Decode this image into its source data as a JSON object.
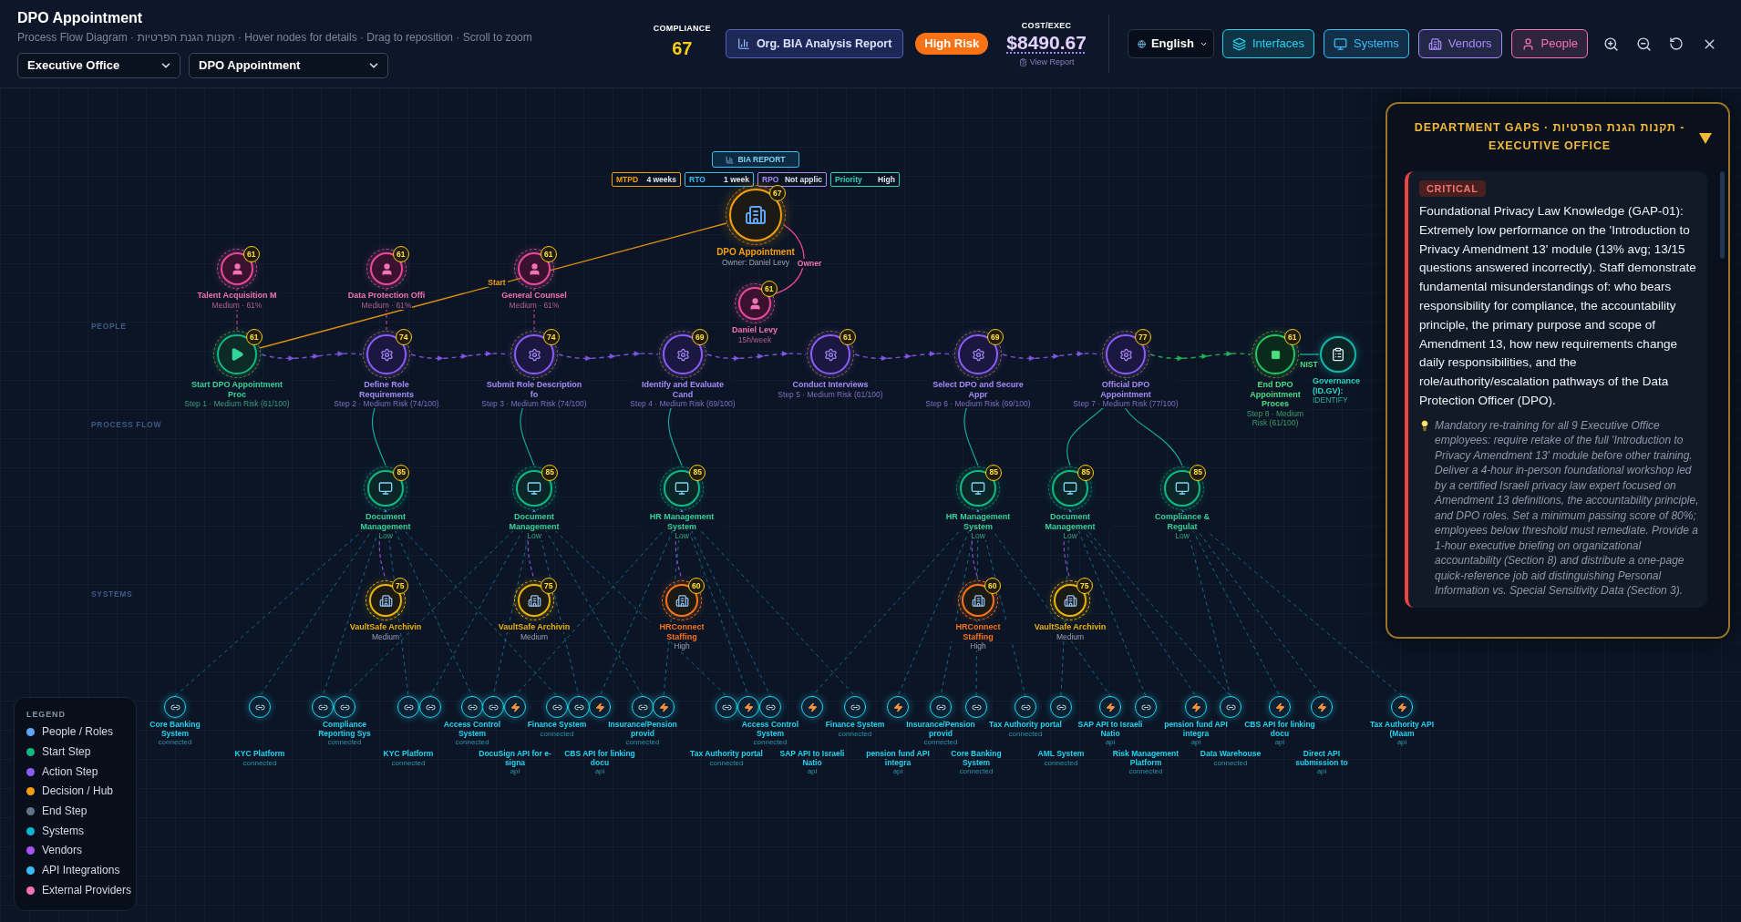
{
  "header": {
    "title": "DPO Appointment",
    "subtitle": "Process Flow Diagram · תקנות הגנת הפרטיות · Hover nodes for details · Drag to reposition · Scroll to zoom",
    "filters": [
      {
        "value": "Executive Office"
      },
      {
        "value": "DPO Appointment"
      }
    ],
    "compliance": {
      "label": "COMPLIANCE",
      "value": "67"
    },
    "report_button": "Org. BIA Analysis Report",
    "risk_badge": "High Risk",
    "cost": {
      "label": "COST/EXEC",
      "value": "$8490.67",
      "link": "View Report"
    },
    "language": "English",
    "layers": [
      {
        "kind": "interfaces",
        "label": "Interfaces",
        "on": true,
        "color": "#22d3ee"
      },
      {
        "kind": "systems",
        "label": "Systems",
        "on": true,
        "color": "#38bdf8"
      },
      {
        "kind": "vendors",
        "label": "Vendors",
        "on": true,
        "color": "#a78bfa"
      },
      {
        "kind": "people",
        "label": "People",
        "on": true,
        "color": "#f472b6"
      }
    ]
  },
  "diagram": {
    "lanes": [
      {
        "label": "PEOPLE"
      },
      {
        "label": "PROCESS FLOW"
      },
      {
        "label": "SYSTEMS"
      }
    ],
    "hub": {
      "report_button": "BIA REPORT",
      "metrics": [
        {
          "label": "MTPD",
          "value": "4 weeks",
          "color": "#f59e0b"
        },
        {
          "label": "RTO",
          "value": "1 week",
          "color": "#38bdf8"
        },
        {
          "label": "RPO",
          "value": "Not applic",
          "color": "#a78bfa"
        },
        {
          "label": "Priority",
          "value": "High",
          "color": "#2dd4bf"
        }
      ],
      "name": "DPO Appointment",
      "owner": "Owner: Daniel Levy",
      "score": "67"
    },
    "edge_labels": [
      {
        "kind": "start",
        "label": "Start"
      },
      {
        "kind": "owner",
        "label": "Owner"
      },
      {
        "kind": "framework",
        "label": "NIST"
      }
    ],
    "people": [
      {
        "name": "Talent Acquisition M",
        "detail": "Medium · 61%",
        "score": "61"
      },
      {
        "name": "Data Protection Offi",
        "detail": "Medium · 61%",
        "score": "61"
      },
      {
        "name": "General Counsel",
        "detail": "Medium · 61%",
        "score": "61"
      },
      {
        "name": "Daniel Levy",
        "detail": "15h/week",
        "score": "61"
      }
    ],
    "steps": [
      {
        "kind": "start",
        "name": "Start DPO Appointment Proc",
        "detail": "Step 1 · Medium Risk (61/100)",
        "score": "61"
      },
      {
        "kind": "action",
        "name": "Define Role Requirements",
        "detail": "Step 2 · Medium Risk (74/100)",
        "score": "74"
      },
      {
        "kind": "action",
        "name": "Submit Role Description fo",
        "detail": "Step 3 · Medium Risk (74/100)",
        "score": "74"
      },
      {
        "kind": "action",
        "name": "Identify and Evaluate Cand",
        "detail": "Step 4 · Medium Risk (69/100)",
        "score": "69"
      },
      {
        "kind": "action",
        "name": "Conduct Interviews",
        "detail": "Step 5 · Medium Risk (61/100)",
        "score": "61"
      },
      {
        "kind": "action",
        "name": "Select DPO and Secure Appr",
        "detail": "Step 6 · Medium Risk (69/100)",
        "score": "69"
      },
      {
        "kind": "action",
        "name": "Official DPO Appointment",
        "detail": "Step 7 · Medium Risk (77/100)",
        "score": "77"
      },
      {
        "kind": "end",
        "name": "End DPO Appointment Proces",
        "detail": "Step 8 · Medium Risk (61/100)",
        "score": "61"
      }
    ],
    "framework": {
      "name": "Governance (ID.GV):",
      "detail": "IDENTIFY"
    },
    "systems": [
      {
        "name": "Document Management",
        "detail": "Low",
        "score": "85"
      },
      {
        "name": "Document Management",
        "detail": "Low",
        "score": "85"
      },
      {
        "name": "HR Management System",
        "detail": "Low",
        "score": "85"
      },
      {
        "name": "HR Management System",
        "detail": "Low",
        "score": "85"
      },
      {
        "name": "Document Management",
        "detail": "Low",
        "score": "85"
      },
      {
        "name": "Compliance & Regulat",
        "detail": "Low",
        "score": "85"
      }
    ],
    "vendors": [
      {
        "name": "VaultSafe Archivin",
        "detail": "Medium",
        "score": "75",
        "color": "#eab308"
      },
      {
        "name": "VaultSafe Archivin",
        "detail": "Medium",
        "score": "75",
        "color": "#eab308"
      },
      {
        "name": "HRConnect Staffing",
        "detail": "High",
        "score": "60",
        "color": "#f97316"
      },
      {
        "name": "HRConnect Staffing",
        "detail": "High",
        "score": "60",
        "color": "#f97316"
      },
      {
        "name": "VaultSafe Archivin",
        "detail": "Medium",
        "score": "75",
        "color": "#eab308"
      }
    ],
    "integrations": [
      {
        "kind": "link",
        "name": "Core Banking System",
        "status": "connected"
      },
      {
        "kind": "link",
        "name": "KYC Platform",
        "status": "connected"
      },
      {
        "kind": "link"
      },
      {
        "kind": "link",
        "name": "Compliance Reporting Sys",
        "status": "connected"
      },
      {
        "kind": "link",
        "name": "KYC Platform",
        "status": "connected"
      },
      {
        "kind": "link"
      },
      {
        "kind": "link",
        "name": "Access Control System",
        "status": "connected"
      },
      {
        "kind": "link"
      },
      {
        "kind": "api",
        "name": "DocuSign API for e-signa",
        "status": "api"
      },
      {
        "kind": "link",
        "name": "Finance System",
        "status": "connected"
      },
      {
        "kind": "link"
      },
      {
        "kind": "api",
        "name": "CBS API for linking docu",
        "status": "api"
      },
      {
        "kind": "link",
        "name": "Insurance/Pension provid",
        "status": "connected"
      },
      {
        "kind": "api"
      },
      {
        "kind": "link",
        "name": "Tax Authority portal",
        "status": "connected"
      },
      {
        "kind": "api"
      },
      {
        "kind": "link",
        "name": "Access Control System",
        "status": "connected"
      },
      {
        "kind": "api",
        "name": "SAP API to Israeli Natio",
        "status": "api"
      },
      {
        "kind": "link",
        "name": "Finance System",
        "status": "connected"
      },
      {
        "kind": "api",
        "name": "pension fund API integra",
        "status": "api"
      },
      {
        "kind": "link",
        "name": "Insurance/Pension provid",
        "status": "connected"
      },
      {
        "kind": "link",
        "name": "Core Banking System",
        "status": "connected"
      },
      {
        "kind": "link",
        "name": "Tax Authority portal",
        "status": "connected"
      },
      {
        "kind": "link",
        "name": "AML System",
        "status": "connected"
      },
      {
        "kind": "api",
        "name": "SAP API to Israeli Natio",
        "status": "api"
      },
      {
        "kind": "link",
        "name": "Risk Management Platform",
        "status": "connected"
      },
      {
        "kind": "api",
        "name": "pension fund API integra",
        "status": "api"
      },
      {
        "kind": "link",
        "name": "Data Warehouse",
        "status": "connected"
      },
      {
        "kind": "api",
        "name": "CBS API for linking docu",
        "status": "api"
      },
      {
        "kind": "api",
        "name": "Direct API submission to",
        "status": "api"
      },
      {
        "kind": "api",
        "name": "Tax Authority API (Maam",
        "status": "api"
      }
    ]
  },
  "legend": {
    "title": "LEGEND",
    "items": [
      {
        "label": "People / Roles",
        "color": "#60a5fa"
      },
      {
        "label": "Start Step",
        "color": "#10b981"
      },
      {
        "label": "Action Step",
        "color": "#8b5cf6"
      },
      {
        "label": "Decision / Hub",
        "color": "#f59e0b"
      },
      {
        "label": "End Step",
        "color": "#64748b"
      },
      {
        "label": "Systems",
        "color": "#06b6d4"
      },
      {
        "label": "Vendors",
        "color": "#a855f7"
      },
      {
        "label": "API Integrations",
        "color": "#38bdf8"
      },
      {
        "label": "External Providers",
        "color": "#f472b6"
      }
    ]
  },
  "gaps_panel": {
    "title": "DEPARTMENT GAPS · תקנות הגנת הפרטיות - EXECUTIVE OFFICE",
    "expanded": true,
    "gaps": [
      {
        "kind": "critical",
        "badge": "CRITICAL",
        "finding": "Foundational Privacy Law Knowledge (GAP-01): Extremely low performance on the 'Introduction to Privacy Amendment 13' module (13% avg; 13/15 questions answered incorrectly). Staff demonstrate fundamental misunderstandings of: who bears responsibility for compliance, the accountability principle, the primary purpose and scope of Amendment 13, how new requirements change daily responsibilities, and the role/authority/escalation pathways of the Data Protection Officer (DPO).",
        "recommendation": "Mandatory re-training for all 9 Executive Office employees: require retake of the full 'Introduction to Privacy Amendment 13' module before other training. Deliver a 4-hour in-person foundational workshop led by a certified Israeli privacy law expert focused on Amendment 13 definitions, the accountability principle, and DPO roles. Set a minimum passing score of 80%; employees below threshold must remediate. Provide a 1-hour executive briefing on organizational accountability (Section 8) and distribute a one-page quick-reference job aid distinguishing Personal Information vs. Special Sensitivity Data (Section 3)."
      }
    ]
  }
}
